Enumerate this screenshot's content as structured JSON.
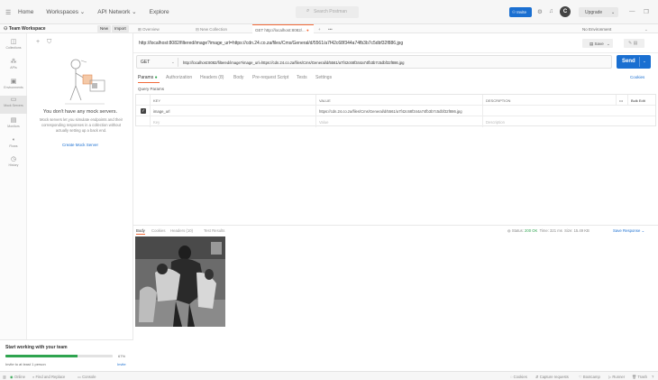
{
  "topbar": {
    "menu_icon": "☰",
    "nav": [
      "Home",
      "Workspaces ⌄",
      "API Network ⌄",
      "Explore"
    ],
    "search_placeholder": "Search Postman",
    "invite_label": "Invite",
    "upgrade_label": "Upgrade",
    "avatar_initial": "C"
  },
  "workspace": {
    "name": "Team Workspace",
    "new_label": "New",
    "import_label": "Import"
  },
  "rail": [
    {
      "icon": "◫",
      "label": "Collections"
    },
    {
      "icon": "⁂",
      "label": "APIs"
    },
    {
      "icon": "▣",
      "label": "Environments"
    },
    {
      "icon": "▭",
      "label": "Mock Servers"
    },
    {
      "icon": "▤",
      "label": "Monitors"
    },
    {
      "icon": "⁌",
      "label": "Flows"
    },
    {
      "icon": "◷",
      "label": "History"
    }
  ],
  "panel": {
    "empty_title": "You don't have any mock servers.",
    "empty_desc": "Mock servers let you simulate endpoints and their corresponding responses in a collection without actually setting up a back end.",
    "create_label": "Create Mock Server"
  },
  "team_card": {
    "title": "Start working with your team",
    "progress": 67,
    "progress_text": "67%",
    "sub": "Invite to at least 1 person",
    "invite": "Invite"
  },
  "tabs": {
    "items": [
      {
        "label": "Overview",
        "active": false
      },
      {
        "label": "New Collection",
        "active": false
      },
      {
        "label": "GET http://localhost:8082/...",
        "active": true
      }
    ],
    "add": "+",
    "more": "•••",
    "env": "No Environment"
  },
  "request": {
    "title_url": "http://localhost:8082/filtered/image?image_url=https://cdn.24.co.za/files/Cms/General/d/5561/a7f42c68f344a74fb3b7c5dbf32f886.jpg",
    "save_label": "Save",
    "method": "GET",
    "url": "http://localhost:8082/filtered/image?image_url=https://cdn.24.co.za/files/Cms/General/d/5561/a7f42c68f344a74fb3b7c5dbf32f886.jpg",
    "send_label": "Send"
  },
  "subtabs": {
    "items": [
      "Params",
      "Authorization",
      "Headers (8)",
      "Body",
      "Pre-request Script",
      "Tests",
      "Settings"
    ],
    "cookies": "Cookies",
    "query_params": "Query Params"
  },
  "params": {
    "headers": [
      "KEY",
      "VALUE",
      "DESCRIPTION"
    ],
    "bulk_edit": "Bulk Edit",
    "more": "•••",
    "rows": [
      {
        "key": "image_url",
        "value": "https://cdn.24.co.za/files/Cms/General/d/5561/a7f42c68f344a74fb3b7c5dbf32f886.jpg",
        "description": ""
      }
    ],
    "placeholders": {
      "key": "Key",
      "value": "Value",
      "description": "Description"
    }
  },
  "response": {
    "tabs": [
      "Body",
      "Cookies",
      "Headers (10)",
      "Test Results"
    ],
    "status_label": "Status:",
    "status_value": "200 OK",
    "time": "Time: 321 ms",
    "size": "Size: 15.49 KB",
    "save": "Save Response ⌄"
  },
  "statusbar": {
    "left": [
      "Online",
      "Find and Replace",
      "Console"
    ],
    "right": [
      "Cookies",
      "Capture requests",
      "Bootcamp",
      "Runner",
      "Trash"
    ]
  }
}
